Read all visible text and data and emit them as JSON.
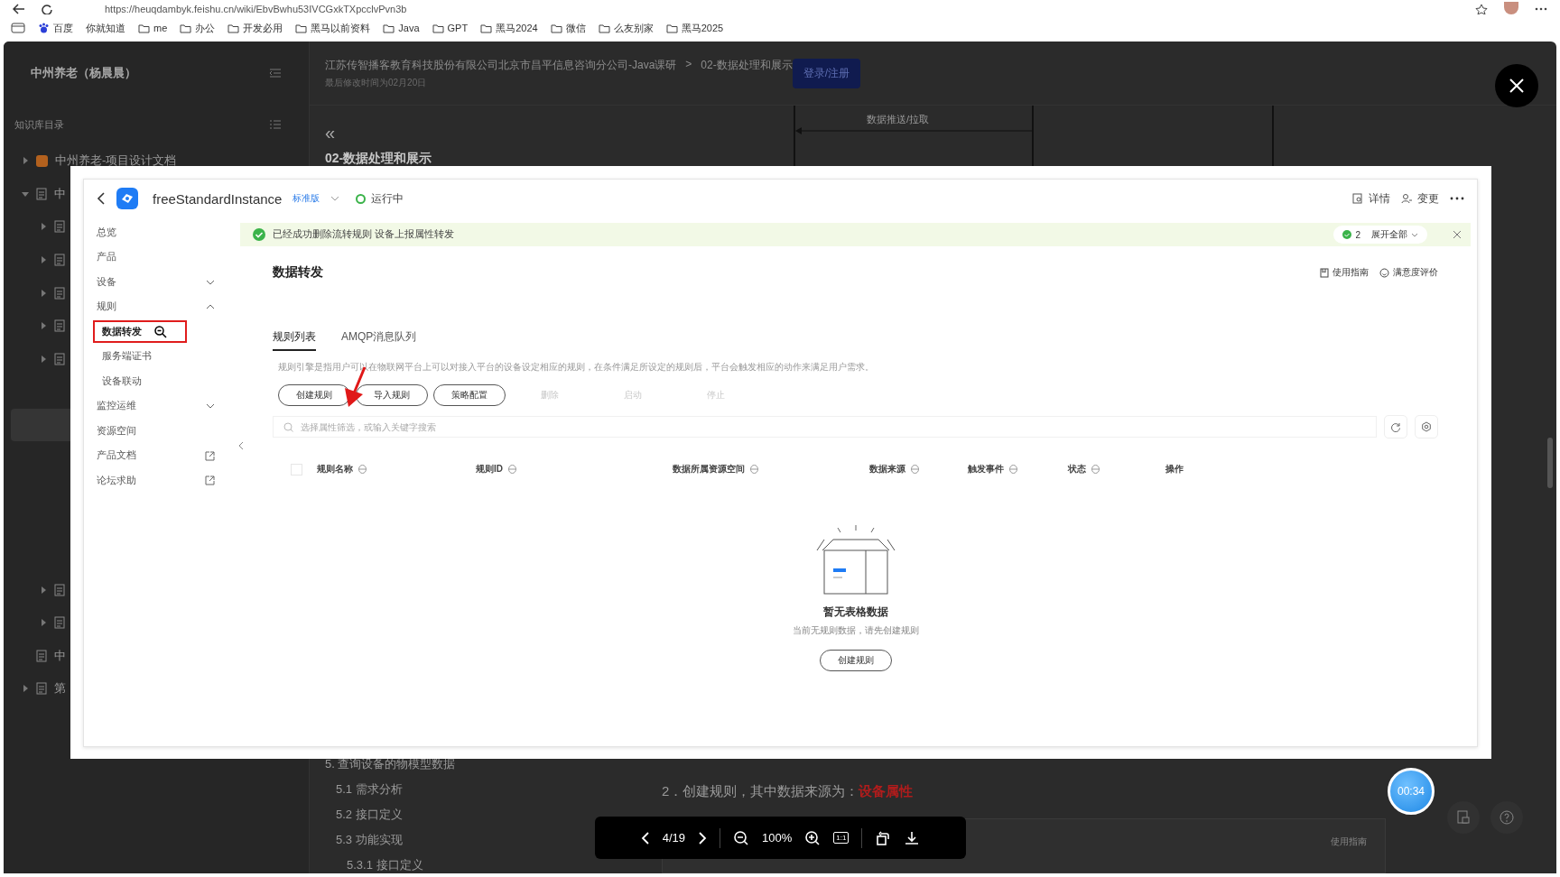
{
  "browser": {
    "url": "https://heuqdambyk.feishu.cn/wiki/EbvBwhu53IVCGxkTXpcclvPvn3b",
    "bookmarks": [
      {
        "label": "百度",
        "kind": "site"
      },
      {
        "label": "你就知道",
        "kind": "site"
      },
      {
        "label": "me",
        "kind": "folder"
      },
      {
        "label": "办公",
        "kind": "folder"
      },
      {
        "label": "开发必用",
        "kind": "folder"
      },
      {
        "label": "黑马以前资料",
        "kind": "folder"
      },
      {
        "label": "Java",
        "kind": "folder"
      },
      {
        "label": "GPT",
        "kind": "folder"
      },
      {
        "label": "黑马2024",
        "kind": "folder"
      },
      {
        "label": "微信",
        "kind": "folder"
      },
      {
        "label": "么友别家",
        "kind": "folder"
      },
      {
        "label": "黑马2025",
        "kind": "folder"
      }
    ]
  },
  "wiki": {
    "space_title": "中州养老（杨晨晨）",
    "toc_label": "知识库目录",
    "tree": [
      {
        "label": "中州养老-项目设计文档",
        "kind": "folder",
        "expanded": false
      },
      {
        "label": "中",
        "kind": "folder",
        "expanded": true,
        "children": [
          {
            "kind": "folder",
            "expanded": false
          },
          {
            "kind": "folder",
            "expanded": false
          },
          {
            "kind": "folder",
            "expanded": false
          },
          {
            "kind": "folder",
            "expanded": false
          },
          {
            "kind": "folder",
            "expanded": false
          },
          {
            "kind": "doc",
            "selected": true
          },
          {
            "kind": "folder",
            "expanded": false
          },
          {
            "kind": "folder",
            "expanded": false
          }
        ]
      },
      {
        "label": "中",
        "kind": "doc"
      },
      {
        "label": "第",
        "kind": "folder",
        "expanded": false
      }
    ],
    "breadcrumb": [
      "江苏传智播客教育科技股份有限公司北京市昌平信息咨询分公司-Java课研",
      "02-数据处理和展示"
    ],
    "breadcrumb_separator": ">",
    "toc_collapse": "«",
    "modified": "最后修改时间为02月20日",
    "login": "登录/注册",
    "doc_title": "02-数据处理和展示",
    "diagram_label": "数据推送/拉取",
    "outline": [
      {
        "label": "5. 查询设备的物模型数据",
        "kind": "chapter"
      },
      {
        "label": "5.1 需求分析",
        "kind": "section"
      },
      {
        "label": "5.2 接口定义",
        "kind": "section"
      },
      {
        "label": "5.3 功能实现",
        "kind": "section"
      },
      {
        "label": "5.3.1 接口定义",
        "kind": "subsection"
      }
    ],
    "step_text": "2．创建规则，其中数据来源为：**设备属性**",
    "inner_caption": "使用指南"
  },
  "viewer": {
    "page": "4/19",
    "zoom": "100%",
    "actual_size": "1:1",
    "timer": "00:34"
  },
  "console": {
    "instance": "freeStandardInstance",
    "edition": "标准版",
    "status": "运行中",
    "header_actions": [
      "详情",
      "变更"
    ],
    "nav": [
      {
        "label": "总览"
      },
      {
        "label": "产品"
      },
      {
        "label": "设备",
        "expanded": false
      },
      {
        "label": "规则",
        "expanded": true,
        "children": [
          {
            "label": "数据转发",
            "selected": true
          },
          {
            "label": "服务端证书",
            "selected": false
          },
          {
            "label": "设备联动",
            "selected": false
          }
        ]
      },
      {
        "label": "监控运维",
        "expanded": false
      },
      {
        "label": "资源空间"
      },
      {
        "label": "产品文档",
        "external": true
      },
      {
        "label": "论坛求助",
        "external": true
      }
    ],
    "alert": {
      "message": "已经成功删除流转规则 设备上报属性转发",
      "count": "2",
      "expand": "展开全部"
    },
    "title": "数据转发",
    "links": [
      "使用指南",
      "满意度评价"
    ],
    "tabs": [
      {
        "label": "规则列表",
        "selected": true
      },
      {
        "label": "AMQP消息队列",
        "selected": false
      }
    ],
    "description": "规则引擎是指用户可以在物联网平台上可以对接入平台的设备设定相应的规则，在条件满足所设定的规则后，平台会触发相应的动作来满足用户需求。",
    "buttons": [
      {
        "label": "创建规则",
        "disabled": false
      },
      {
        "label": "导入规则",
        "disabled": false
      },
      {
        "label": "策略配置",
        "disabled": false
      },
      {
        "label": "删除",
        "disabled": true
      },
      {
        "label": "启动",
        "disabled": true
      },
      {
        "label": "停止",
        "disabled": true
      }
    ],
    "search": {
      "placeholder": "选择属性筛选，或输入关键字搜索"
    },
    "table": {
      "select_all_checked": false,
      "columns": [
        "规则名称",
        "规则ID",
        "数据所属资源空间",
        "数据来源",
        "触发事件",
        "状态",
        "操作"
      ]
    },
    "empty": {
      "title": "暂无表格数据",
      "hint": "当前无规则数据，请先创建规则",
      "action": "创建规则"
    }
  }
}
